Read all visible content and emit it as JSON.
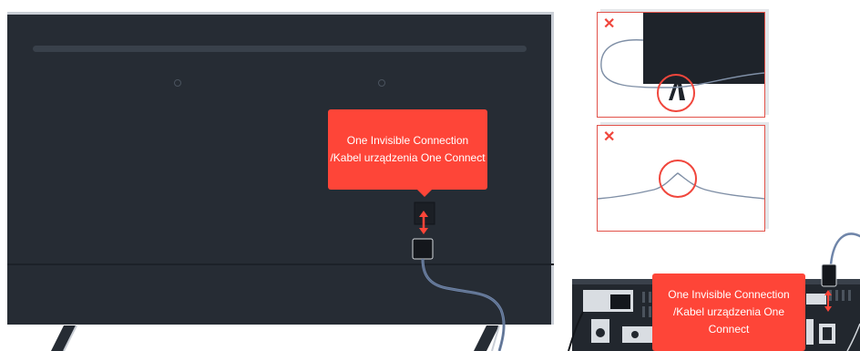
{
  "callouts": {
    "main_line1": "One Invisible Connection",
    "main_line2": "/Kabel urządzenia One Connect",
    "box_line1": "One Invisible Connection",
    "box_line2": "/Kabel urządzenia One Connect"
  },
  "panels": {
    "wrong_symbol_a": "✕",
    "wrong_symbol_b": "✕"
  },
  "colors": {
    "accent": "#fe4538",
    "tv_body": "#262c34",
    "cable": "#6f85a9"
  }
}
